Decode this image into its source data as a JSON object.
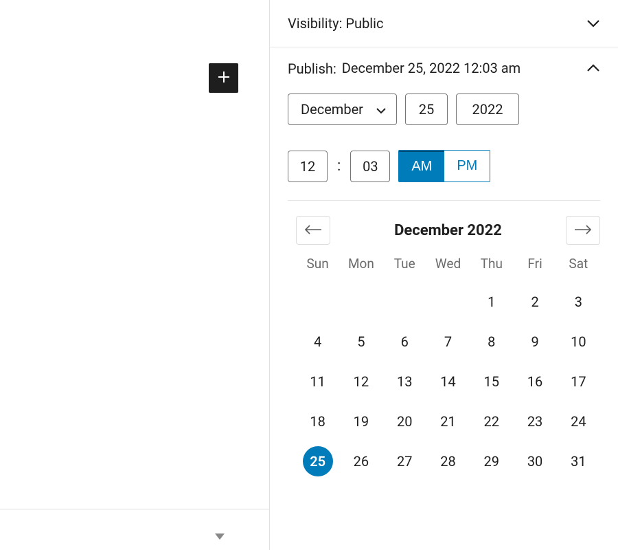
{
  "visibility": {
    "label": "Visibility:",
    "value": "Public"
  },
  "publish": {
    "label": "Publish:",
    "value": "December 25, 2022 12:03 am"
  },
  "datetime": {
    "month": "December",
    "day": "25",
    "year": "2022",
    "hour": "12",
    "minute": "03",
    "am": "AM",
    "pm": "PM",
    "selected_ampm": "AM"
  },
  "calendar": {
    "title": "December 2022",
    "dow": [
      "Sun",
      "Mon",
      "Tue",
      "Wed",
      "Thu",
      "Fri",
      "Sat"
    ],
    "leading_blanks": 4,
    "days": 31,
    "selected": 25
  },
  "colors": {
    "accent": "#007cba"
  }
}
